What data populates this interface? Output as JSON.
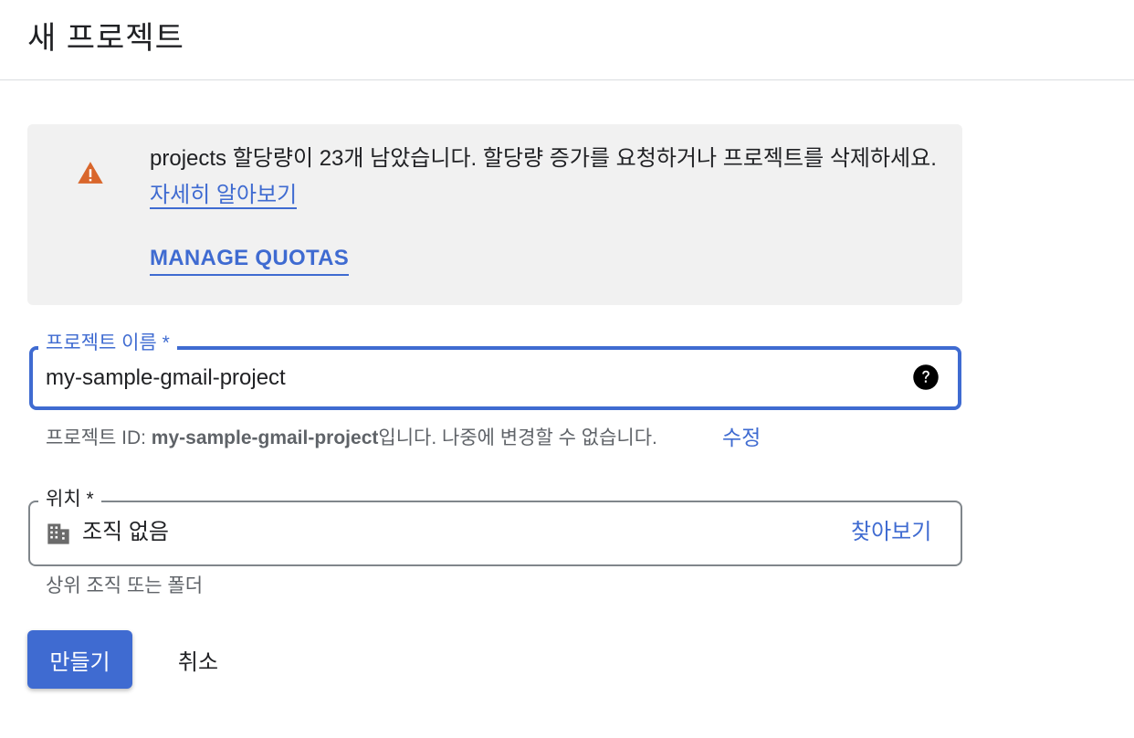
{
  "header": {
    "title": "새 프로젝트"
  },
  "notice": {
    "message": "projects 할당량이 23개 남았습니다. 할당량 증가를 요청하거나 프로젝트를 삭제하세요.",
    "learn_more": "자세히 알아보기",
    "manage_quotas": "MANAGE QUOTAS",
    "icon": "warning-icon",
    "icon_color": "#d9662b"
  },
  "project_name": {
    "label": "프로젝트 이름 *",
    "value": "my-sample-gmail-project",
    "help_icon": "help-icon"
  },
  "project_id": {
    "prefix": "프로젝트 ID: ",
    "id": "my-sample-gmail-project",
    "suffix": "입니다. 나중에 변경할 수 없습니다.",
    "edit": "수정"
  },
  "location": {
    "label": "위치 *",
    "value": "조직 없음",
    "browse": "찾아보기",
    "hint": "상위 조직 또는 폴더",
    "icon": "organization-icon"
  },
  "actions": {
    "create": "만들기",
    "cancel": "취소"
  },
  "colors": {
    "accent": "#3f6bd1",
    "warning": "#d9662b",
    "notice_bg": "#f1f1f1"
  }
}
